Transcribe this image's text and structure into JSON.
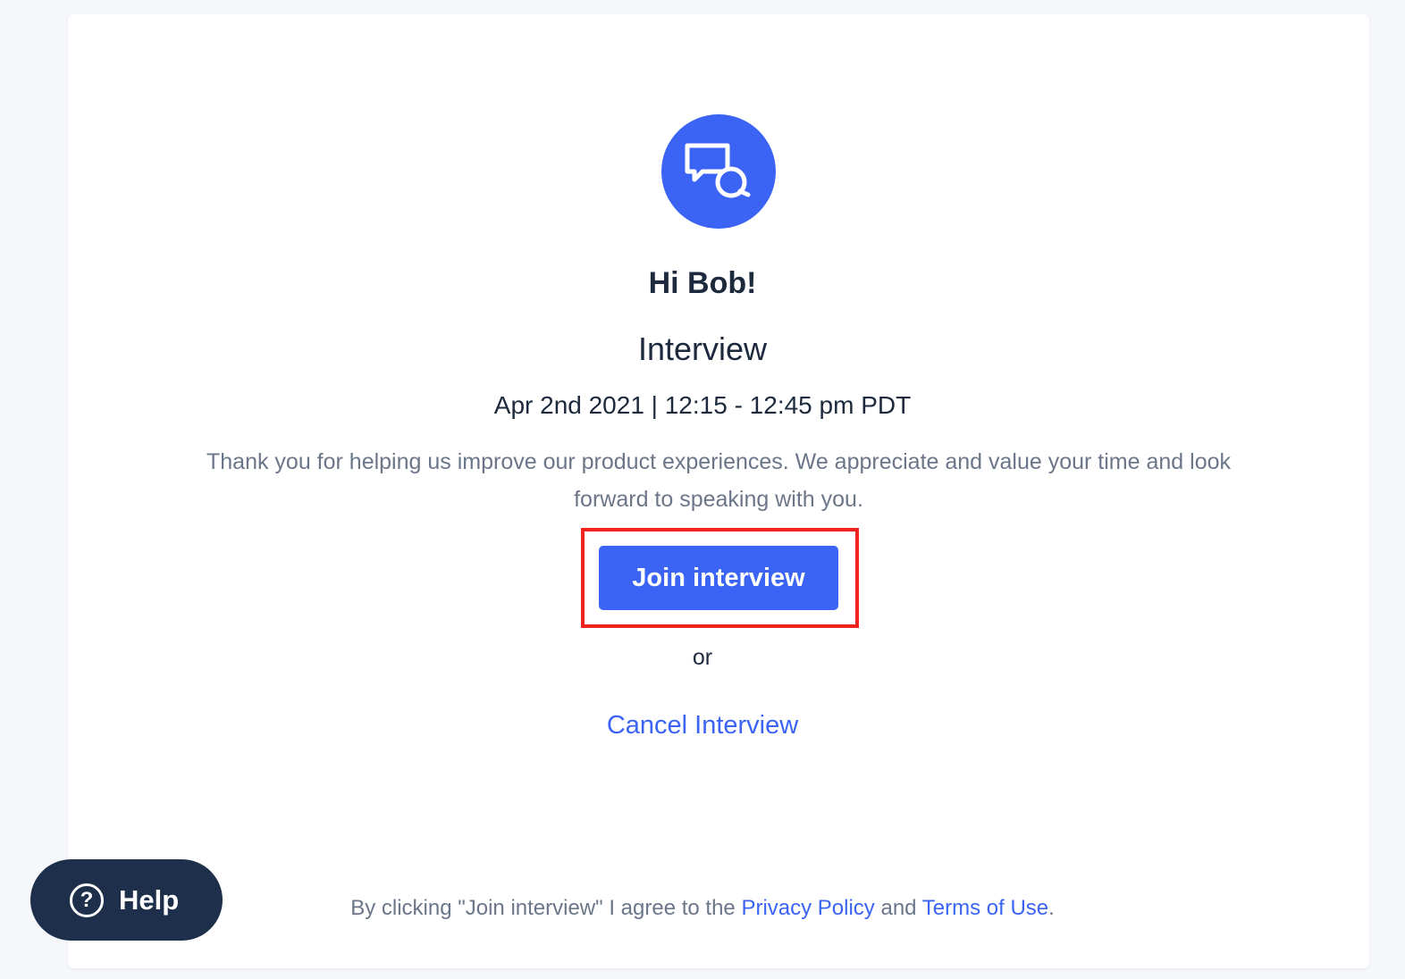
{
  "colors": {
    "accent": "#3b64f5",
    "heading_text": "#1d2a3d",
    "muted_text": "#6b7689",
    "help_bg": "#1d2f4a",
    "highlight_border": "#f0241c",
    "page_bg": "#f5f7fa"
  },
  "logo": {
    "icon": "chat-bubbles-icon"
  },
  "greeting": "Hi Bob!",
  "session": {
    "title": "Interview",
    "datetime": "Apr 2nd 2021 | 12:15 - 12:45 pm PDT"
  },
  "message": "Thank you for helping us improve our product experiences. We appreciate and value your time and look forward to speaking with you.",
  "actions": {
    "join_label": "Join interview",
    "or_text": "or",
    "cancel_label": "Cancel Interview"
  },
  "footer": {
    "prefix": "By clicking \"Join interview\" I agree to the",
    "privacy_label": "Privacy Policy",
    "and_text": "and",
    "terms_label": "Terms of Use",
    "suffix": "."
  },
  "help": {
    "icon": "question-mark-icon",
    "glyph": "?",
    "label": "Help"
  }
}
